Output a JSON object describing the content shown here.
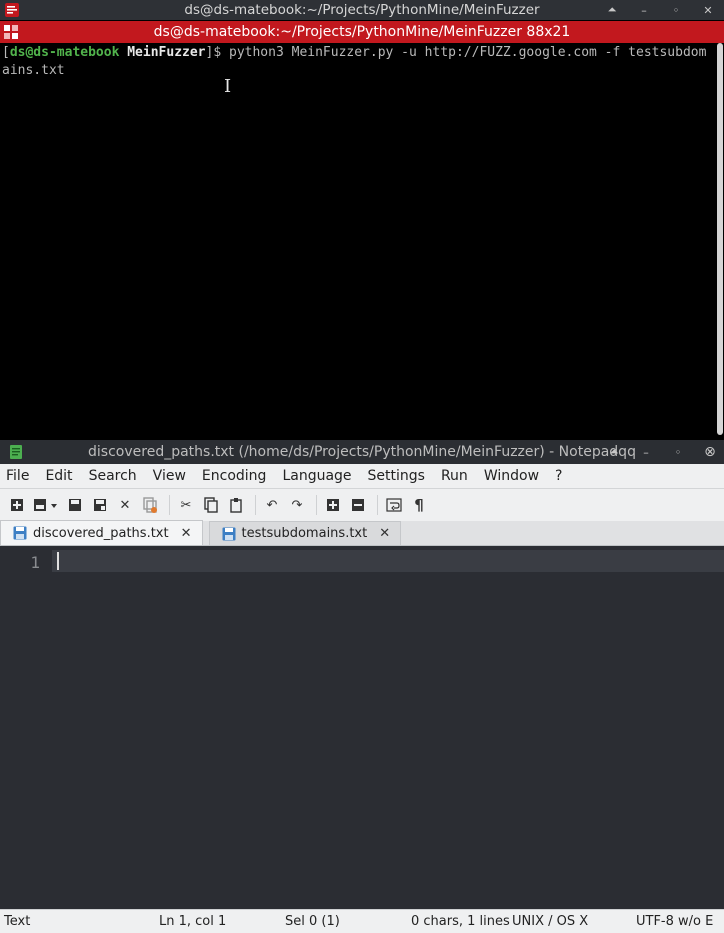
{
  "terminal": {
    "window_title": "ds@ds-matebook:~/Projects/PythonMine/MeinFuzzer",
    "tab_title": "ds@ds-matebook:~/Projects/PythonMine/MeinFuzzer 88x21",
    "prompt": {
      "open_bracket": "[",
      "user_host": "ds@ds-matebook",
      "dir": "MeinFuzzer",
      "close_bracket": "]$ "
    },
    "command": "python3 MeinFuzzer.py -u http://FUZZ.google.com -f testsubdomains.txt"
  },
  "notepad": {
    "window_title": "discovered_paths.txt (/home/ds/Projects/PythonMine/MeinFuzzer) - Notepadqq",
    "menu": [
      "File",
      "Edit",
      "Search",
      "View",
      "Encoding",
      "Language",
      "Settings",
      "Run",
      "Window",
      "?"
    ],
    "tabs": [
      {
        "label": "discovered_paths.txt",
        "active": true
      },
      {
        "label": "testsubdomains.txt",
        "active": false
      }
    ],
    "line_number": "1",
    "status": {
      "language": "Text",
      "position": "Ln 1, col 1",
      "selection": "Sel 0 (1)",
      "counts": "0 chars, 1 lines",
      "eol": "UNIX / OS X",
      "encoding": "UTF-8 w/o E"
    }
  },
  "colors": {
    "terminal_accent": "#c2181e",
    "prompt_user": "#51b34c",
    "editor_bg": "#2b2d33",
    "toolbar_bg": "#eff0f1"
  },
  "icons": {
    "window_controls": [
      "shade-icon",
      "minimize-icon",
      "restore-icon",
      "close-icon"
    ]
  }
}
